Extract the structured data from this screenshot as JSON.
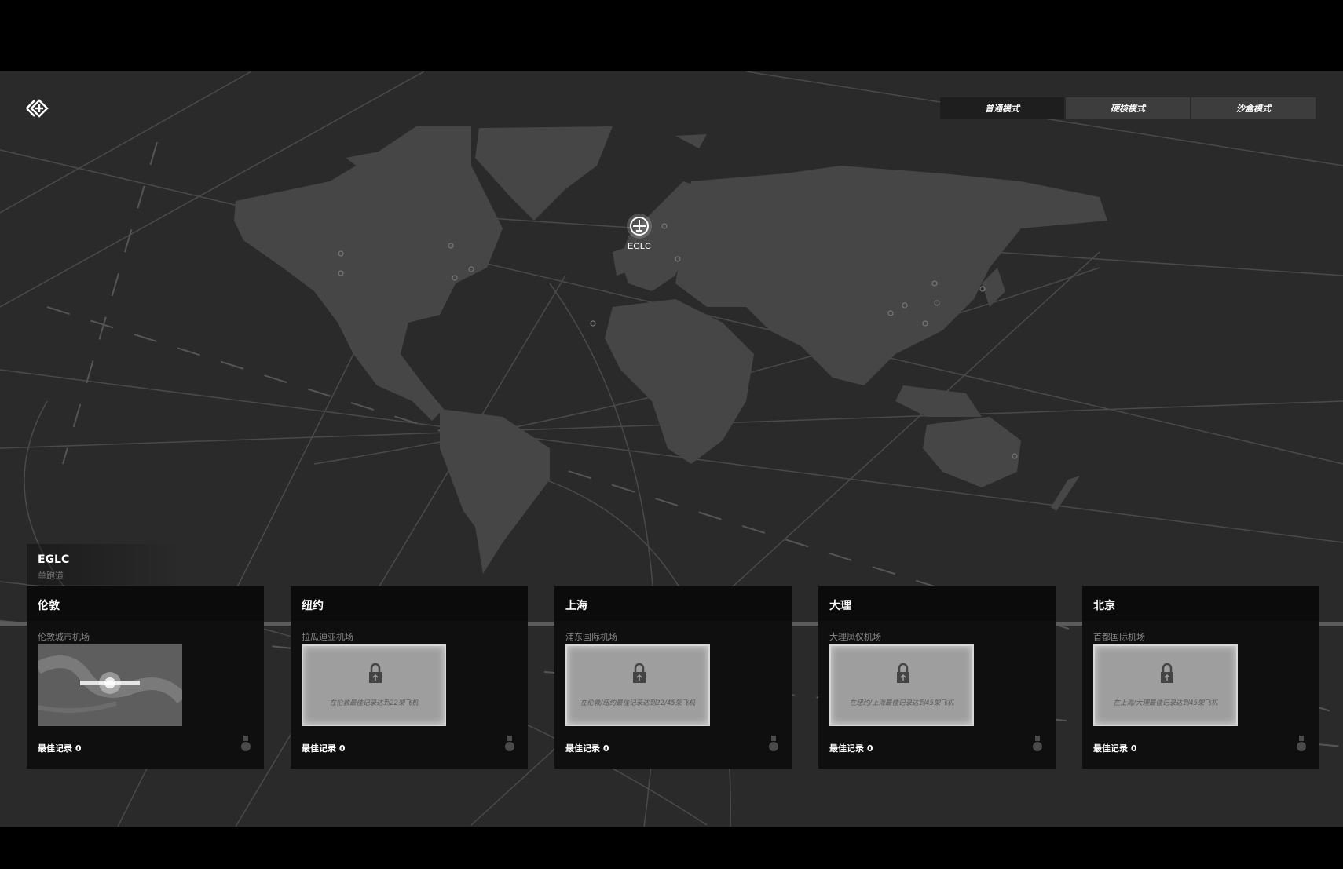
{
  "modes": [
    {
      "label": "普通模式",
      "active": true
    },
    {
      "label": "硬核模式",
      "active": false
    },
    {
      "label": "沙盒模式",
      "active": false
    }
  ],
  "map": {
    "selected_marker_label": "EGLC"
  },
  "selected": {
    "code": "EGLC",
    "subtitle": "单跑道"
  },
  "cards": [
    {
      "city": "伦敦",
      "airport": "伦敦城市机场",
      "locked": false,
      "lock_text": "",
      "best": "最佳记录 0"
    },
    {
      "city": "纽约",
      "airport": "拉瓜迪亚机场",
      "locked": true,
      "lock_text": "在伦敦最佳记录达到22架飞机",
      "best": "最佳记录 0"
    },
    {
      "city": "上海",
      "airport": "浦东国际机场",
      "locked": true,
      "lock_text": "在伦敦/纽约最佳记录达到22/45架飞机",
      "best": "最佳记录 0"
    },
    {
      "city": "大理",
      "airport": "大理凤仪机场",
      "locked": true,
      "lock_text": "在纽约/上海最佳记录达到45架飞机",
      "best": "最佳记录 0"
    },
    {
      "city": "北京",
      "airport": "首都国际机场",
      "locked": true,
      "lock_text": "在上海/大理最佳记录达到45架飞机",
      "best": "最佳记录 0"
    }
  ],
  "colors": {
    "background": "#2a2a2a",
    "land": "#444444",
    "card": "#0f0f0f",
    "accent": "#ffffff"
  }
}
